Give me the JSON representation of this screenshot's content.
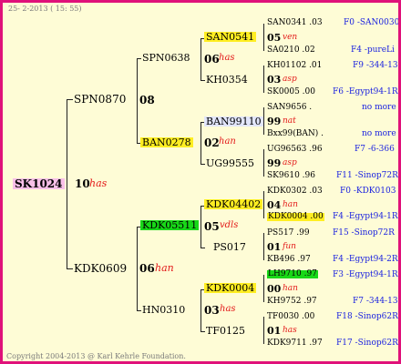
{
  "header": {
    "date": "25- 2-2013 ( 15: 55)"
  },
  "footer": {
    "copyright": "Copyright 2004-2013 @ Karl Kehrle Foundation."
  },
  "root": {
    "id": "SK1024",
    "year": "10",
    "race": "has"
  },
  "gen1": [
    {
      "id": "SPN0870"
    },
    {
      "id": "KDK0609",
      "year": "06",
      "race": "han"
    }
  ],
  "gen2_sires": [
    {
      "id": "SPN0638"
    },
    {
      "id": "BAN0278",
      "year": "02",
      "race": "han"
    },
    {
      "id": "KDK05511",
      "year": "05",
      "race": "vdls"
    },
    {
      "id": "HN0310",
      "year": "03",
      "race": "has"
    }
  ],
  "gen2_marks": {
    "g2a_year": "08"
  },
  "gen3": [
    {
      "id": "SAN0541",
      "year": "06",
      "race": "has"
    },
    {
      "id": "KH0354"
    },
    {
      "id": "BAN99110",
      "year": "99",
      "race": "nat"
    },
    {
      "id": "UG99555"
    },
    {
      "id": "KDK04402",
      "year": "04",
      "race": "han"
    },
    {
      "id": "PS017"
    },
    {
      "id": "KDK0004",
      "year": "00",
      "race": "han"
    },
    {
      "id": "TF0125"
    }
  ],
  "gen4": [
    {
      "id": "SAN0341 .03",
      "source": "F0 -SAN0030"
    },
    {
      "year": "05",
      "race": "ven"
    },
    {
      "id": "SA0210 .02",
      "source": "F4 -pureLi"
    },
    {
      "id": "KH01102 .01",
      "source": "F9 -344-13"
    },
    {
      "year": "03",
      "race": "asp"
    },
    {
      "id": "SK0005 .00",
      "source": "F6 -Egypt94-1R"
    },
    {
      "id": "SAN9656 .",
      "source": "no more"
    },
    {
      "year": "99",
      "race": "nat"
    },
    {
      "id": "Bxx99(BAN) .",
      "source": "no more"
    },
    {
      "id": "UG96563 .96",
      "source": "F7 -6-366"
    },
    {
      "year": "99",
      "race": "asp"
    },
    {
      "id": "SK9610 .96",
      "source": "F11 -Sinop72R"
    },
    {
      "id": "KDK0302 .03",
      "source": "F0 -KDK0103"
    },
    {
      "year": "04",
      "race": "han"
    },
    {
      "id": "KDK0004 .00",
      "source": "F4 -Egypt94-1R"
    },
    {
      "id": "PS517 .99",
      "source": "F15 -Sinop72R"
    },
    {
      "year": "01",
      "race": "fun"
    },
    {
      "id": "KB496 .97",
      "source": "F4 -Egypt94-2R"
    },
    {
      "id": "LH9710 .97",
      "source": "F3 -Egypt94-1R"
    },
    {
      "year": "00",
      "race": "han"
    },
    {
      "id": "KH9752 .97",
      "source": "F7 -344-13"
    },
    {
      "id": "TF0030 .00",
      "source": "F18 -Sinop62R"
    },
    {
      "year": "01",
      "race": "has"
    },
    {
      "id": "KDK9711 .97",
      "source": "F17 -Sinop62R"
    }
  ]
}
